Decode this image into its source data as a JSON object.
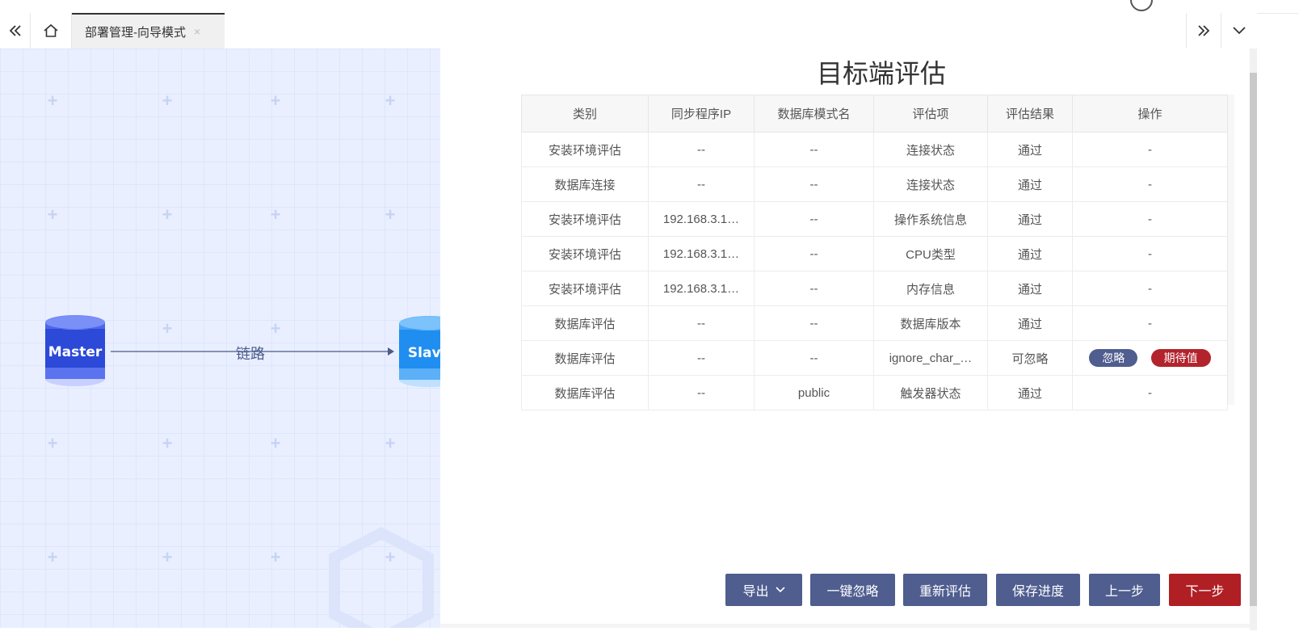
{
  "tabs": {
    "active_label": "部署管理-向导模式",
    "close_glyph": "×"
  },
  "topology": {
    "master_label": "Master",
    "slave_label": "Slave",
    "link_label": "链路"
  },
  "panel": {
    "title": "目标端评估"
  },
  "table": {
    "headers": [
      "类别",
      "同步程序IP",
      "数据库模式名",
      "评估项",
      "评估结果",
      "操作"
    ],
    "rows": [
      [
        "安装环境评估",
        "--",
        "--",
        "连接状态",
        "通过",
        "-"
      ],
      [
        "数据库连接",
        "--",
        "--",
        "连接状态",
        "通过",
        "-"
      ],
      [
        "安装环境评估",
        "192.168.3.1…",
        "--",
        "操作系统信息",
        "通过",
        "-"
      ],
      [
        "安装环境评估",
        "192.168.3.1…",
        "--",
        "CPU类型",
        "通过",
        "-"
      ],
      [
        "安装环境评估",
        "192.168.3.1…",
        "--",
        "内存信息",
        "通过",
        "-"
      ],
      [
        "数据库评估",
        "--",
        "--",
        "数据库版本",
        "通过",
        "-"
      ],
      [
        "数据库评估",
        "--",
        "--",
        "ignore_char_…",
        "可忽略",
        ""
      ],
      [
        "数据库评估",
        "--",
        "public",
        "触发器状态",
        "通过",
        "-"
      ]
    ],
    "row7_actions": {
      "ignore": "忽略",
      "expected": "期待值"
    }
  },
  "footer": {
    "export": "导出",
    "ignore_all": "一键忽略",
    "reassess": "重新评估",
    "save_progress": "保存进度",
    "prev": "上一步",
    "next": "下一步"
  },
  "colors": {
    "primary_button": "#4f5d8f",
    "danger_button": "#b01f24",
    "canvas_bg": "#e9efff",
    "master_db": "#2d49d8",
    "slave_db": "#1f8ef0"
  }
}
